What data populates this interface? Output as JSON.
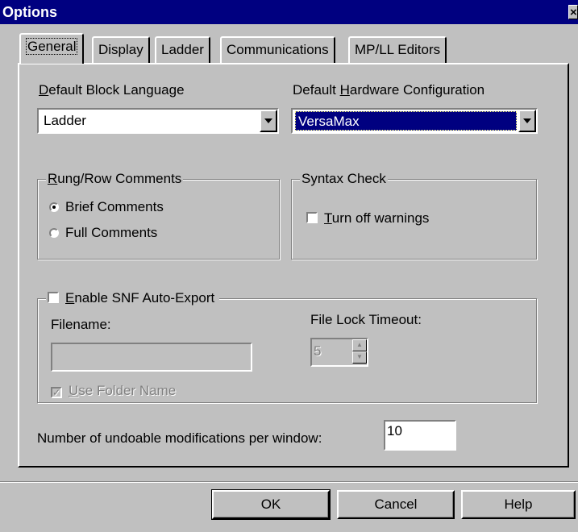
{
  "window": {
    "title": "Options",
    "close_glyph": "×"
  },
  "tabs": [
    {
      "label": "General",
      "active": true
    },
    {
      "label": "Display"
    },
    {
      "label": "Ladder"
    },
    {
      "label": "Communications"
    },
    {
      "label": "MP/LL Editors"
    }
  ],
  "general": {
    "block_language": {
      "label_prefix": "",
      "label_key": "D",
      "label_rest": "efault Block Language",
      "value": "Ladder"
    },
    "hw_config": {
      "label_prefix": "Default ",
      "label_key": "H",
      "label_rest": "ardware Configuration",
      "value": "VersaMax"
    },
    "rung_comments": {
      "title_key": "R",
      "title_rest": "ung/Row Comments",
      "options": [
        "Brief Comments",
        "Full Comments"
      ],
      "selected": "Brief Comments"
    },
    "syntax_check": {
      "title": "Syntax Check",
      "option_key": "T",
      "option_rest": "urn off warnings",
      "checked": false
    },
    "snf_export": {
      "label_key": "E",
      "label_rest": "nable SNF Auto-Export",
      "checked": false,
      "filename_label": "Filename:",
      "filename_value": "",
      "lock_label": "File Lock Timeout:",
      "lock_value": "5",
      "use_folder_key": "U",
      "use_folder_rest": "se Folder Name",
      "use_folder_checked": true
    },
    "undo": {
      "label": "Number of undoable modifications per window:",
      "value": "10"
    }
  },
  "buttons": {
    "ok": "OK",
    "cancel": "Cancel",
    "help": "Help"
  },
  "colors": {
    "face": "#c0c0c0",
    "title": "#000080"
  }
}
